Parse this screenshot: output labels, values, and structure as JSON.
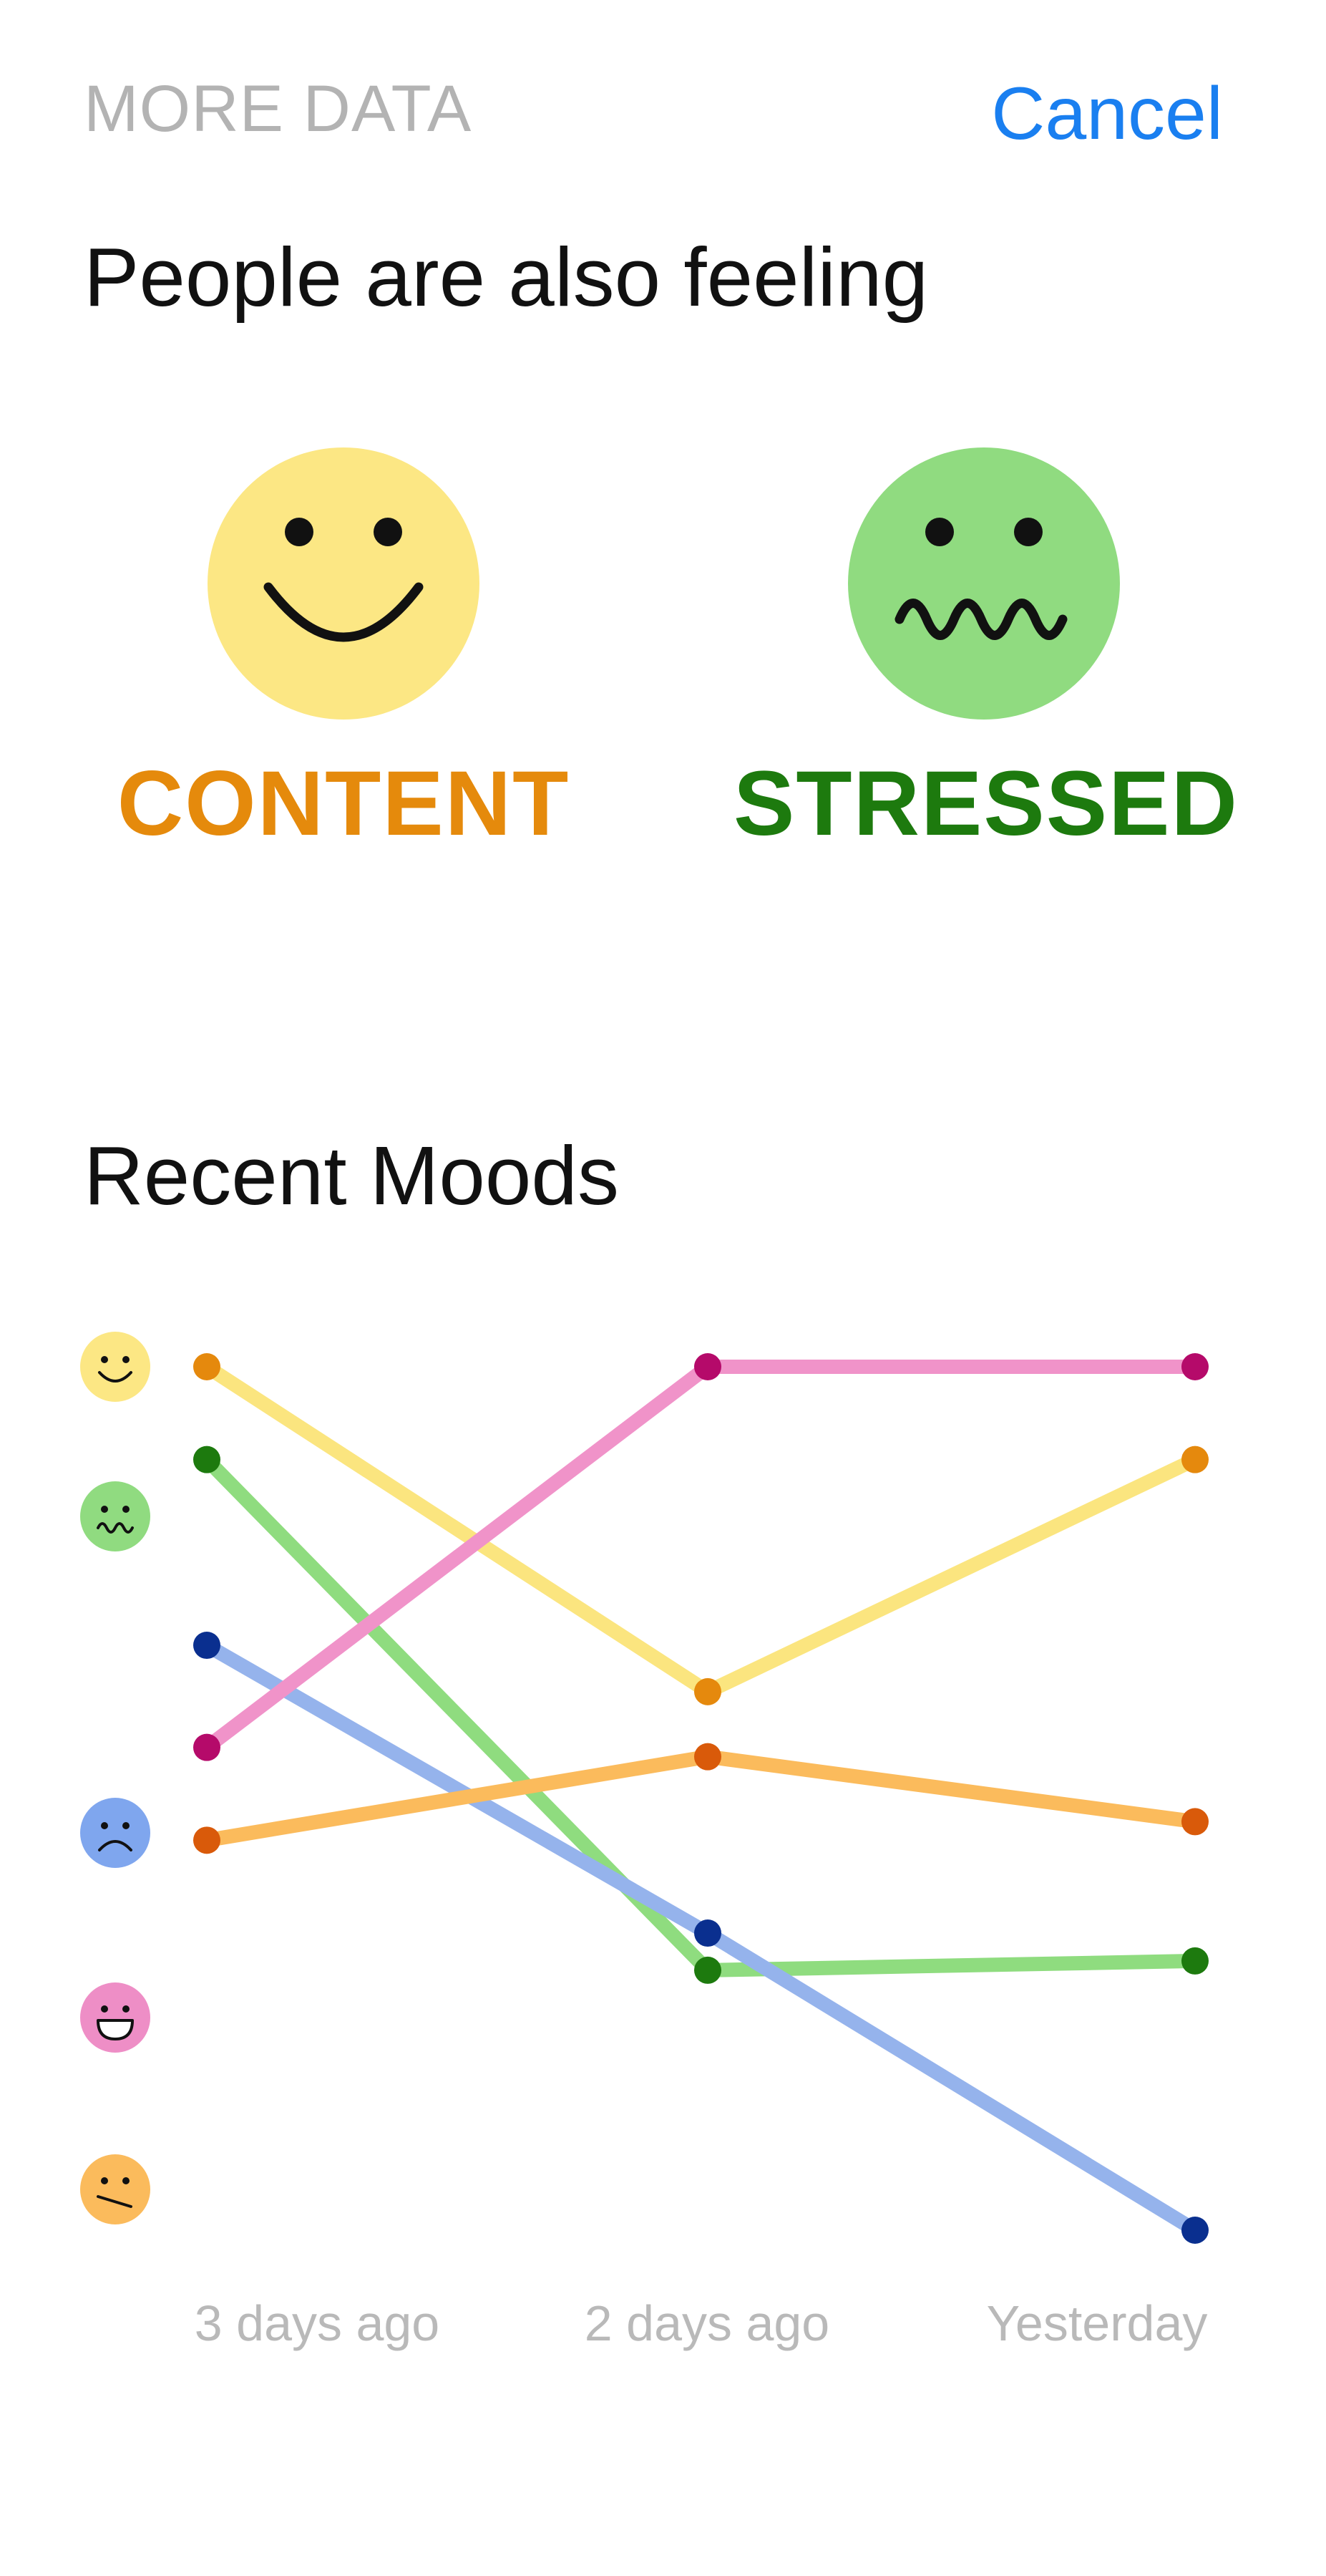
{
  "header": {
    "title": "MORE DATA",
    "cancel_label": "Cancel"
  },
  "also_feeling": {
    "title": "People are also feeling",
    "moods": [
      {
        "label": "CONTENT",
        "icon": "content-face-icon",
        "face_color": "#fce784",
        "label_color": "#e58a0c"
      },
      {
        "label": "STRESSED",
        "icon": "stressed-face-icon",
        "face_color": "#90db80",
        "label_color": "#1d7a0e"
      }
    ]
  },
  "recent_moods": {
    "title": "Recent Moods",
    "rows": [
      {
        "icon": "content-face-icon",
        "color": "#fce784"
      },
      {
        "icon": "stressed-face-icon",
        "color": "#90db80"
      },
      {
        "icon": "sad-face-icon",
        "color": "#7fa6ee"
      },
      {
        "icon": "excited-face-icon",
        "color": "#ee8ec6"
      },
      {
        "icon": "meh-face-icon",
        "color": "#fbbb5c"
      }
    ]
  },
  "chart_data": {
    "type": "line",
    "x": [
      "3 days ago",
      "2 days ago",
      "Yesterday"
    ],
    "series": [
      {
        "line_color": "#fbe57f",
        "point_color": "#e5890d",
        "values": [
          1,
          4.5,
          2
        ]
      },
      {
        "line_color": "#8fdc7f",
        "point_color": "#1d7a0e",
        "values": [
          2,
          7.5,
          7.4
        ]
      },
      {
        "line_color": "#95b3ec",
        "point_color": "#0a2f8f",
        "values": [
          4,
          7.1,
          10.3
        ]
      },
      {
        "line_color": "#f093c9",
        "point_color": "#b50a6a",
        "values": [
          5.1,
          1,
          1
        ]
      },
      {
        "line_color": "#fbbb5c",
        "point_color": "#d95a0a",
        "values": [
          6.1,
          5.2,
          5.9
        ]
      }
    ],
    "ylim": [
      1,
      10.3
    ],
    "grid": false
  }
}
